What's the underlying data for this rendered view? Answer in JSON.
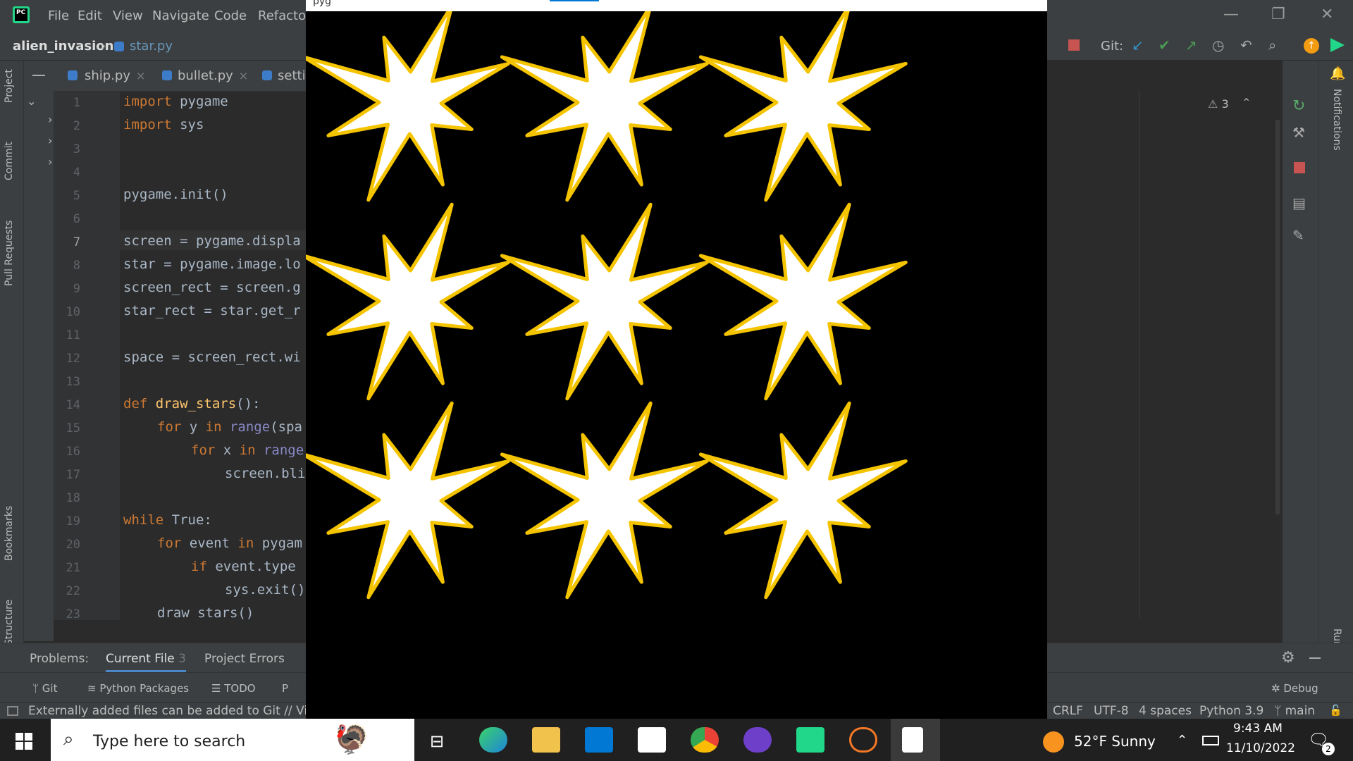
{
  "menu": [
    "File",
    "Edit",
    "View",
    "Navigate",
    "Code",
    "Refactor"
  ],
  "app_logo_text": "PC",
  "window_controls": {
    "minimize": "—",
    "restore": "❐",
    "close": "✕"
  },
  "breadcrumb": {
    "project": "alien_invasion",
    "separator": "›",
    "file": "star.py"
  },
  "toolbar": {
    "git_label": "Git:",
    "warnings": "3"
  },
  "tabs": [
    {
      "label": "ship.py",
      "close": "×"
    },
    {
      "label": "bullet.py",
      "close": "×"
    },
    {
      "label": "settir",
      "close": ""
    }
  ],
  "left_stripe": [
    "Project",
    "Commit",
    "Pull Requests",
    "Bookmarks",
    "Structure"
  ],
  "right_stripe": [
    "Notifications",
    "Run"
  ],
  "line_numbers": [
    "1",
    "2",
    "3",
    "4",
    "5",
    "6",
    "7",
    "8",
    "9",
    "10",
    "11",
    "12",
    "13",
    "14",
    "15",
    "16",
    "17",
    "18",
    "19",
    "20",
    "21",
    "22",
    "23"
  ],
  "code": {
    "l1_kw": "import",
    "l1_rest": " pygame",
    "l2_kw": "import",
    "l2_rest": " sys",
    "l5": "pygame.init()",
    "l7": "screen = pygame.displa",
    "l8": "star = pygame.image.lo",
    "l9": "screen_rect = screen.g",
    "l10": "star_rect = star.get_r",
    "l12": "space = screen_rect.wi",
    "l14_kw": "def",
    "l14_fn": "draw_stars",
    "l14_rest": "():",
    "l15_kw": "for",
    "l15_a": " y ",
    "l15_in": "in",
    "l15_bi": " range",
    "l15_rest": "(spa",
    "l16_kw": "for",
    "l16_a": " x ",
    "l16_in": "in",
    "l16_bi": " range",
    "l17": "screen.bli",
    "l19_kw": "while",
    "l19_rest": " True:",
    "l20_kw": "for",
    "l20_a": " event ",
    "l20_in": "in",
    "l20_rest": " pygam",
    "l21_kw": "if",
    "l21_rest": " event.type",
    "l22": "sys.exit()",
    "l23": "draw stars()"
  },
  "problems": {
    "label": "Problems:",
    "tab_current": "Current File",
    "current_count": "3",
    "tab_project": "Project Errors"
  },
  "bottom_tools": [
    "Git",
    "Python Packages",
    "TODO",
    "P"
  ],
  "debug_label": "Debug",
  "status": {
    "message": "Externally added files can be added to Git // View",
    "line_sep": "CRLF",
    "encoding": "UTF-8",
    "indent": "4 spaces",
    "interpreter": "Python 3.9",
    "branch": "main"
  },
  "game_window": {
    "title": "pyg"
  },
  "taskbar": {
    "search_placeholder": "Type here to search",
    "weather": "52°F  Sunny",
    "time": "9:43 AM",
    "date": "11/10/2022",
    "notif_count": "2"
  },
  "colors": {
    "star_fill": "#ffffff",
    "star_outline": "#f5c400",
    "background": "#000000"
  }
}
